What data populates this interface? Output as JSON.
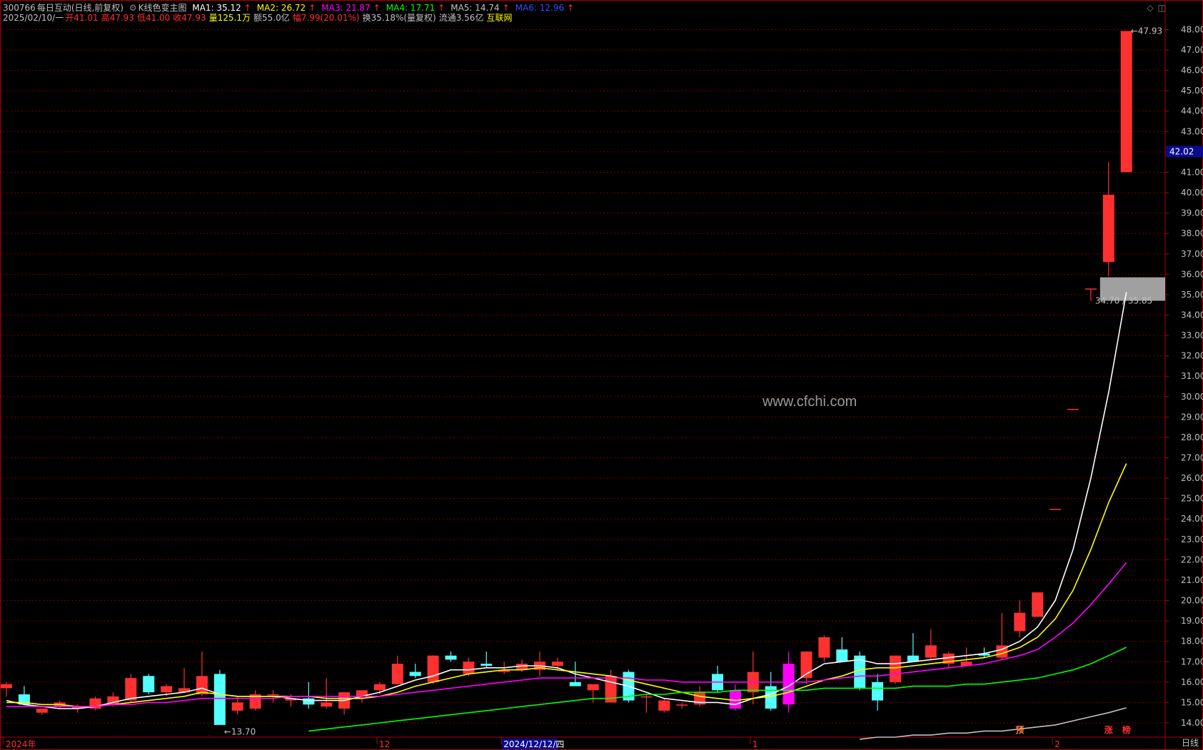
{
  "header": {
    "code": "300766",
    "name": "每日互动(日线,前复权)",
    "indicator": "K线色变主图",
    "ma": [
      {
        "label": "MA1: 35.12",
        "color": "#ffffff"
      },
      {
        "label": "MA2: 26.72",
        "color": "#ffff00"
      },
      {
        "label": "MA3: 21.87",
        "color": "#ff00ff"
      },
      {
        "label": "MA4: 17.71",
        "color": "#00ff00"
      },
      {
        "label": "MA5: 14.74",
        "color": "#c0c0c0"
      },
      {
        "label": "MA6: 12.96",
        "color": "#3050ff"
      }
    ],
    "arrow": "↑",
    "date": "2025/02/10/一",
    "open": "开41.01",
    "high": "高47.93",
    "low": "低41.00",
    "close": "收47.93",
    "volume": "量125.1万",
    "amount": "额55.0亿",
    "change": "幅7.99(20.01%)",
    "turnover": "换35.18%(量复权)",
    "float": "流通3.56亿",
    "sector": "互联网"
  },
  "icons": [
    "diamond-icon",
    "window-icon"
  ],
  "watermark": "www.cfchi.com",
  "timeframe": "日线",
  "chart_data": {
    "type": "candlestick",
    "yaxis": {
      "min": 13.3,
      "max": 48.4,
      "side": "right",
      "ticks": [
        "14.00",
        "15.00",
        "16.00",
        "17.00",
        "18.00",
        "19.00",
        "20.00",
        "21.00",
        "22.00",
        "23.00",
        "24.00",
        "25.00",
        "26.00",
        "27.00",
        "28.00",
        "29.00",
        "30.00",
        "31.00",
        "32.00",
        "33.00",
        "34.00",
        "35.00",
        "36.00",
        "37.00",
        "38.00",
        "39.00",
        "40.00",
        "41.00",
        "42.00",
        "43.00",
        "44.00",
        "45.00",
        "46.00",
        "47.00",
        "48.00"
      ],
      "current_price": "42.02",
      "current_price_value": 42.02
    },
    "xaxis": {
      "labels": [
        {
          "text": "2024年",
          "index": 0
        },
        {
          "text": "12",
          "index": 21
        },
        {
          "text": "2024/12/12/四",
          "index": 28,
          "highlight": true
        },
        {
          "text": "1",
          "index": 42
        },
        {
          "text": "2",
          "index": 59
        }
      ]
    },
    "candles": [
      [
        15.7,
        16.0,
        15.3,
        15.9
      ],
      [
        15.4,
        15.8,
        14.9,
        14.9
      ],
      [
        14.5,
        14.7,
        14.4,
        14.7
      ],
      [
        14.8,
        15.1,
        14.7,
        15.0
      ],
      [
        14.7,
        14.9,
        14.5,
        14.8
      ],
      [
        14.7,
        15.3,
        14.6,
        15.2
      ],
      [
        14.9,
        15.5,
        14.8,
        15.3
      ],
      [
        15.1,
        16.4,
        15.0,
        16.2
      ],
      [
        16.3,
        16.4,
        15.4,
        15.5
      ],
      [
        15.5,
        15.9,
        15.3,
        15.8
      ],
      [
        15.5,
        16.7,
        15.5,
        15.7
      ],
      [
        15.4,
        17.5,
        15.3,
        16.3
      ],
      [
        16.4,
        16.6,
        13.9,
        13.9
      ],
      [
        14.6,
        15.3,
        14.4,
        15.0
      ],
      [
        14.7,
        15.6,
        14.6,
        15.4
      ],
      [
        15.4,
        15.6,
        15.0,
        15.4
      ],
      [
        15.1,
        15.4,
        14.8,
        15.2
      ],
      [
        15.2,
        16.0,
        14.7,
        14.9
      ],
      [
        14.8,
        16.2,
        14.7,
        15.0
      ],
      [
        14.7,
        15.5,
        14.4,
        15.5
      ],
      [
        15.3,
        15.6,
        15.0,
        15.6
      ],
      [
        15.6,
        16.0,
        15.4,
        15.9
      ],
      [
        15.9,
        17.3,
        15.9,
        16.9
      ],
      [
        16.5,
        16.9,
        16.2,
        16.3
      ],
      [
        16.0,
        17.3,
        15.9,
        17.3
      ],
      [
        17.3,
        17.5,
        17.0,
        17.1
      ],
      [
        16.4,
        17.2,
        16.3,
        17.0
      ],
      [
        16.9,
        17.5,
        16.7,
        16.8
      ],
      [
        16.5,
        17.0,
        16.4,
        16.6
      ],
      [
        16.6,
        17.1,
        16.5,
        16.9
      ],
      [
        16.6,
        17.5,
        16.3,
        17.0
      ],
      [
        16.8,
        17.2,
        16.6,
        17.0
      ],
      [
        16.0,
        17.0,
        15.8,
        15.8
      ],
      [
        15.6,
        15.9,
        15.0,
        15.9
      ],
      [
        15.0,
        16.6,
        15.0,
        16.3
      ],
      [
        16.5,
        16.6,
        15.0,
        15.1
      ],
      [
        15.3,
        15.4,
        14.5,
        15.3
      ],
      [
        14.6,
        15.2,
        14.5,
        15.1
      ],
      [
        14.9,
        15.0,
        14.7,
        14.9
      ],
      [
        14.9,
        15.8,
        14.8,
        15.5
      ],
      [
        16.4,
        16.8,
        15.5,
        15.6
      ],
      [
        15.6,
        15.9,
        14.6,
        14.7
      ],
      [
        15.5,
        17.5,
        14.9,
        16.5
      ],
      [
        15.8,
        16.5,
        14.6,
        14.7
      ],
      [
        14.9,
        17.5,
        14.5,
        16.9
      ],
      [
        16.2,
        16.9,
        15.9,
        17.5
      ],
      [
        17.2,
        18.3,
        17.0,
        18.2
      ],
      [
        17.6,
        18.2,
        17.0,
        17.0
      ],
      [
        17.3,
        17.5,
        15.6,
        15.7
      ],
      [
        16.0,
        16.4,
        14.6,
        15.1
      ],
      [
        16.0,
        17.3,
        15.9,
        17.3
      ],
      [
        17.3,
        18.4,
        17.1,
        17.0
      ],
      [
        17.2,
        18.6,
        17.1,
        17.8
      ],
      [
        16.9,
        17.5,
        16.7,
        17.4
      ],
      [
        16.8,
        17.7,
        16.8,
        17.0
      ],
      [
        17.4,
        17.7,
        17.2,
        17.3
      ],
      [
        17.2,
        19.4,
        17.1,
        17.8
      ],
      [
        18.5,
        20.0,
        18.2,
        19.4
      ],
      [
        19.2,
        20.4,
        19.2,
        20.4
      ],
      [
        24.5,
        24.5,
        24.5,
        24.5
      ],
      [
        29.4,
        29.4,
        29.4,
        29.4
      ],
      [
        35.3,
        35.3,
        34.7,
        35.3
      ],
      [
        36.6,
        41.5,
        35.9,
        39.9
      ],
      [
        41.01,
        47.93,
        41.0,
        47.93
      ]
    ],
    "ma_series": [
      {
        "label": "MA1",
        "color": "#ffffff",
        "start": 0,
        "values": [
          15.1,
          14.9,
          14.8,
          14.7,
          14.7,
          14.8,
          15.0,
          15.2,
          15.3,
          15.4,
          15.5,
          15.7,
          15.4,
          15.3,
          15.3,
          15.3,
          15.2,
          15.1,
          15.1,
          15.1,
          15.3,
          15.5,
          15.8,
          16.1,
          16.3,
          16.6,
          16.6,
          16.7,
          16.7,
          16.8,
          16.8,
          16.7,
          16.4,
          16.2,
          16.0,
          15.8,
          15.5,
          15.2,
          15.1,
          15.0,
          15.0,
          14.9,
          15.2,
          15.4,
          15.8,
          16.4,
          16.9,
          17.0,
          17.1,
          16.9,
          16.9,
          17.0,
          17.1,
          17.2,
          17.3,
          17.4,
          17.6,
          18.0,
          18.7,
          20.0,
          22.5,
          26.0,
          30.2,
          35.12
        ]
      },
      {
        "label": "MA2",
        "color": "#ffff00",
        "start": 0,
        "values": [
          15.0,
          15.0,
          14.9,
          14.9,
          14.8,
          14.8,
          14.9,
          15.0,
          15.1,
          15.2,
          15.3,
          15.5,
          15.4,
          15.3,
          15.3,
          15.3,
          15.3,
          15.3,
          15.2,
          15.2,
          15.2,
          15.3,
          15.5,
          15.8,
          16.0,
          16.2,
          16.4,
          16.5,
          16.6,
          16.6,
          16.7,
          16.6,
          16.5,
          16.4,
          16.3,
          16.1,
          15.9,
          15.7,
          15.5,
          15.3,
          15.2,
          15.1,
          15.2,
          15.3,
          15.5,
          15.8,
          16.1,
          16.3,
          16.6,
          16.7,
          16.7,
          16.8,
          16.9,
          17.0,
          17.1,
          17.2,
          17.4,
          17.7,
          18.2,
          19.1,
          20.5,
          22.5,
          24.8,
          26.72
        ]
      },
      {
        "label": "MA3",
        "color": "#ff00ff",
        "start": 0,
        "values": [
          14.8,
          14.8,
          14.8,
          14.8,
          14.8,
          14.8,
          14.9,
          14.9,
          15.0,
          15.0,
          15.1,
          15.2,
          15.2,
          15.2,
          15.2,
          15.2,
          15.3,
          15.3,
          15.3,
          15.3,
          15.3,
          15.3,
          15.4,
          15.5,
          15.6,
          15.7,
          15.8,
          15.9,
          16.0,
          16.1,
          16.2,
          16.2,
          16.2,
          16.2,
          16.2,
          16.2,
          16.1,
          16.1,
          16.0,
          16.0,
          16.0,
          16.0,
          16.0,
          16.0,
          16.0,
          16.0,
          16.1,
          16.2,
          16.3,
          16.3,
          16.4,
          16.5,
          16.6,
          16.7,
          16.8,
          16.9,
          17.1,
          17.3,
          17.6,
          18.2,
          18.9,
          19.8,
          20.8,
          21.87
        ]
      },
      {
        "label": "MA4",
        "color": "#00ff00",
        "start": 17,
        "values": [
          13.6,
          13.7,
          13.8,
          13.9,
          14.0,
          14.1,
          14.2,
          14.3,
          14.4,
          14.5,
          14.6,
          14.7,
          14.8,
          14.9,
          15.0,
          15.1,
          15.2,
          15.2,
          15.3,
          15.4,
          15.4,
          15.5,
          15.5,
          15.5,
          15.6,
          15.6,
          15.6,
          15.6,
          15.6,
          15.7,
          15.7,
          15.7,
          15.7,
          15.7,
          15.8,
          15.8,
          15.8,
          15.9,
          15.9,
          16.0,
          16.1,
          16.2,
          16.4,
          16.6,
          16.9,
          17.3,
          17.71
        ]
      },
      {
        "label": "MA5",
        "color": "#c0c0c0",
        "start": 48,
        "values": [
          13.2,
          13.3,
          13.3,
          13.4,
          13.4,
          13.5,
          13.5,
          13.6,
          13.6,
          13.7,
          13.8,
          13.9,
          14.1,
          14.3,
          14.5,
          14.74
        ]
      }
    ],
    "annotations": [
      {
        "text": "←13.70",
        "index": 12,
        "value": 13.7
      },
      {
        "text": "←47.93",
        "index": 63,
        "value": 47.93
      },
      {
        "text": "34.70 / 35.85",
        "index": 61,
        "value": 34.7
      }
    ],
    "gap_box": {
      "from": 34.7,
      "to": 35.85,
      "start_index": 62
    },
    "bottom_markers": [
      {
        "text": "预",
        "index": 57,
        "color": "#ff8040"
      },
      {
        "text": "涨",
        "index": 62,
        "color": "#ff3030"
      },
      {
        "text": "榜",
        "index": 63,
        "color": "#ff3030"
      }
    ]
  }
}
